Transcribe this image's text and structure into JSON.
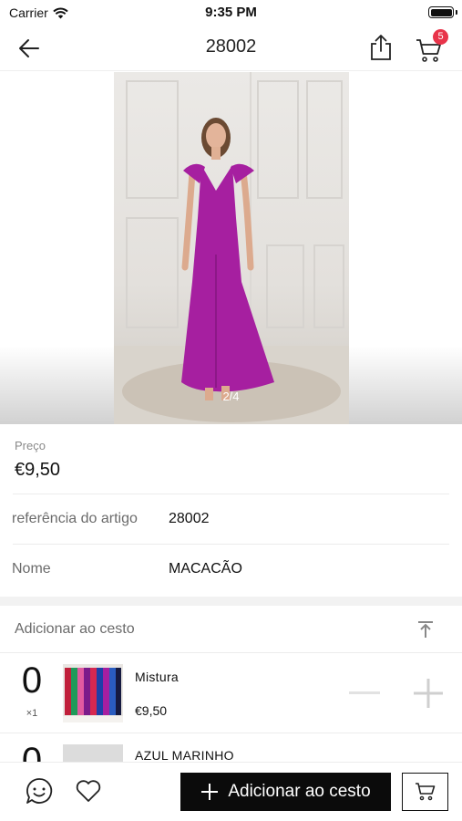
{
  "status_bar": {
    "carrier": "Carrier",
    "time": "9:35 PM"
  },
  "nav": {
    "title": "28002",
    "cart_count": "5"
  },
  "gallery": {
    "page_indicator": "2/4"
  },
  "product": {
    "price_label": "Preço",
    "price": "€9,50",
    "reference_label": "referência do artigo",
    "reference": "28002",
    "name_label": "Nome",
    "name": "MACACÃO"
  },
  "cart_section": {
    "header": "Adicionar ao cesto",
    "items": [
      {
        "qty": "0",
        "multiplier": "×1",
        "name": "Mistura",
        "price": "€9,50"
      },
      {
        "qty": "0",
        "multiplier": "",
        "name": "AZUL MARINHO",
        "price": ""
      }
    ]
  },
  "bottom_bar": {
    "add_label": "Adicionar ao cesto"
  },
  "colors": {
    "accent_badge": "#e8344a",
    "dress": "#a61fa0",
    "button_bg": "#0b0b0b"
  }
}
